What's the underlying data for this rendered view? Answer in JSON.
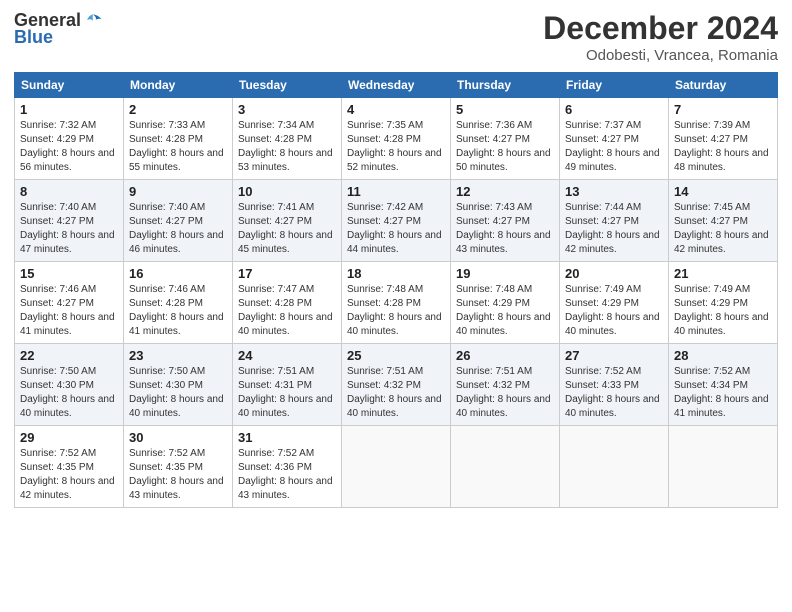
{
  "header": {
    "logo_general": "General",
    "logo_blue": "Blue",
    "month_title": "December 2024",
    "location": "Odobesti, Vrancea, Romania"
  },
  "days_of_week": [
    "Sunday",
    "Monday",
    "Tuesday",
    "Wednesday",
    "Thursday",
    "Friday",
    "Saturday"
  ],
  "weeks": [
    [
      {
        "day": "1",
        "sunrise": "7:32 AM",
        "sunset": "4:29 PM",
        "daylight": "8 hours and 56 minutes."
      },
      {
        "day": "2",
        "sunrise": "7:33 AM",
        "sunset": "4:28 PM",
        "daylight": "8 hours and 55 minutes."
      },
      {
        "day": "3",
        "sunrise": "7:34 AM",
        "sunset": "4:28 PM",
        "daylight": "8 hours and 53 minutes."
      },
      {
        "day": "4",
        "sunrise": "7:35 AM",
        "sunset": "4:28 PM",
        "daylight": "8 hours and 52 minutes."
      },
      {
        "day": "5",
        "sunrise": "7:36 AM",
        "sunset": "4:27 PM",
        "daylight": "8 hours and 50 minutes."
      },
      {
        "day": "6",
        "sunrise": "7:37 AM",
        "sunset": "4:27 PM",
        "daylight": "8 hours and 49 minutes."
      },
      {
        "day": "7",
        "sunrise": "7:39 AM",
        "sunset": "4:27 PM",
        "daylight": "8 hours and 48 minutes."
      }
    ],
    [
      {
        "day": "8",
        "sunrise": "7:40 AM",
        "sunset": "4:27 PM",
        "daylight": "8 hours and 47 minutes."
      },
      {
        "day": "9",
        "sunrise": "7:40 AM",
        "sunset": "4:27 PM",
        "daylight": "8 hours and 46 minutes."
      },
      {
        "day": "10",
        "sunrise": "7:41 AM",
        "sunset": "4:27 PM",
        "daylight": "8 hours and 45 minutes."
      },
      {
        "day": "11",
        "sunrise": "7:42 AM",
        "sunset": "4:27 PM",
        "daylight": "8 hours and 44 minutes."
      },
      {
        "day": "12",
        "sunrise": "7:43 AM",
        "sunset": "4:27 PM",
        "daylight": "8 hours and 43 minutes."
      },
      {
        "day": "13",
        "sunrise": "7:44 AM",
        "sunset": "4:27 PM",
        "daylight": "8 hours and 42 minutes."
      },
      {
        "day": "14",
        "sunrise": "7:45 AM",
        "sunset": "4:27 PM",
        "daylight": "8 hours and 42 minutes."
      }
    ],
    [
      {
        "day": "15",
        "sunrise": "7:46 AM",
        "sunset": "4:27 PM",
        "daylight": "8 hours and 41 minutes."
      },
      {
        "day": "16",
        "sunrise": "7:46 AM",
        "sunset": "4:28 PM",
        "daylight": "8 hours and 41 minutes."
      },
      {
        "day": "17",
        "sunrise": "7:47 AM",
        "sunset": "4:28 PM",
        "daylight": "8 hours and 40 minutes."
      },
      {
        "day": "18",
        "sunrise": "7:48 AM",
        "sunset": "4:28 PM",
        "daylight": "8 hours and 40 minutes."
      },
      {
        "day": "19",
        "sunrise": "7:48 AM",
        "sunset": "4:29 PM",
        "daylight": "8 hours and 40 minutes."
      },
      {
        "day": "20",
        "sunrise": "7:49 AM",
        "sunset": "4:29 PM",
        "daylight": "8 hours and 40 minutes."
      },
      {
        "day": "21",
        "sunrise": "7:49 AM",
        "sunset": "4:29 PM",
        "daylight": "8 hours and 40 minutes."
      }
    ],
    [
      {
        "day": "22",
        "sunrise": "7:50 AM",
        "sunset": "4:30 PM",
        "daylight": "8 hours and 40 minutes."
      },
      {
        "day": "23",
        "sunrise": "7:50 AM",
        "sunset": "4:30 PM",
        "daylight": "8 hours and 40 minutes."
      },
      {
        "day": "24",
        "sunrise": "7:51 AM",
        "sunset": "4:31 PM",
        "daylight": "8 hours and 40 minutes."
      },
      {
        "day": "25",
        "sunrise": "7:51 AM",
        "sunset": "4:32 PM",
        "daylight": "8 hours and 40 minutes."
      },
      {
        "day": "26",
        "sunrise": "7:51 AM",
        "sunset": "4:32 PM",
        "daylight": "8 hours and 40 minutes."
      },
      {
        "day": "27",
        "sunrise": "7:52 AM",
        "sunset": "4:33 PM",
        "daylight": "8 hours and 40 minutes."
      },
      {
        "day": "28",
        "sunrise": "7:52 AM",
        "sunset": "4:34 PM",
        "daylight": "8 hours and 41 minutes."
      }
    ],
    [
      {
        "day": "29",
        "sunrise": "7:52 AM",
        "sunset": "4:35 PM",
        "daylight": "8 hours and 42 minutes."
      },
      {
        "day": "30",
        "sunrise": "7:52 AM",
        "sunset": "4:35 PM",
        "daylight": "8 hours and 43 minutes."
      },
      {
        "day": "31",
        "sunrise": "7:52 AM",
        "sunset": "4:36 PM",
        "daylight": "8 hours and 43 minutes."
      },
      null,
      null,
      null,
      null
    ]
  ]
}
